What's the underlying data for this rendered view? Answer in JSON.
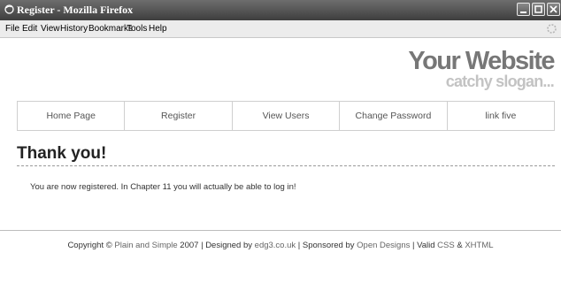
{
  "window": {
    "title": "Register - Mozilla Firefox",
    "buttons": [
      "minimize-icon",
      "maximize-icon",
      "close-icon"
    ]
  },
  "menubar": {
    "items": [
      "File",
      "Edit",
      "View",
      "History",
      "Bookmarks",
      "Tools",
      "Help"
    ]
  },
  "header": {
    "site_title": "Your Website",
    "slogan": "catchy slogan..."
  },
  "nav": {
    "items": [
      "Home Page",
      "Register",
      "View Users",
      "Change Password",
      "link five"
    ]
  },
  "content": {
    "heading": "Thank you!",
    "message": "You are now registered. In Chapter 11 you will actually be able to log in!"
  },
  "footer": {
    "copyright_prefix": "Copyright © ",
    "plain_simple": "Plain and Simple",
    "year_designed": " 2007 | Designed by ",
    "designer": "edg3.co.uk",
    "sponsored": " | Sponsored by ",
    "sponsor": "Open Designs",
    "valid": " | Valid ",
    "css": "CSS",
    "amp": " & ",
    "xhtml": "XHTML"
  }
}
